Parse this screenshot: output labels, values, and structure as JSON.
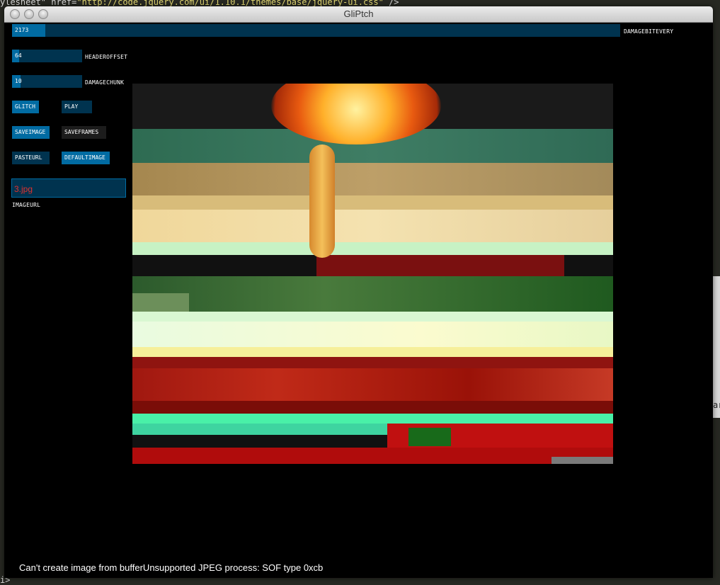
{
  "window": {
    "title": "GliPtch"
  },
  "background_editor": {
    "top_line_parts": [
      "ylesheet\" href=",
      "\"http://code.jquery.com/ui/1.10.1/themes/base/jquery-ui.css\"",
      " />"
    ],
    "bottom_line": "i>",
    "right_edge_text": "ar"
  },
  "controls": {
    "damagebitevery": {
      "label": "DAMAGEBITEVERY",
      "value": "2173",
      "fill_fraction": 0.055
    },
    "headeroffset": {
      "label": "HEADEROFFSET",
      "value": "64",
      "fill_fraction": 0.1
    },
    "damagechunk": {
      "label": "DAMAGECHUNK",
      "value": "10",
      "fill_fraction": 0.12
    },
    "buttons": {
      "glitch": "GLITCH",
      "play": "PLAY",
      "saveimage": "SAVEIMAGE",
      "saveframes": "SAVEFRAMES",
      "pasteurl": "PASTEURL",
      "defaultimage": "DEFAULTIMAGE"
    },
    "imageurl": {
      "label": "IMAGEURL",
      "value": "3.jpg"
    }
  },
  "status": {
    "message": "Can't create image from bufferUnsupported JPEG process: SOF type 0xcb"
  },
  "colors": {
    "slider_bg": "#00334f",
    "slider_fill": "#016ba2",
    "url_text": "#e0322f"
  }
}
